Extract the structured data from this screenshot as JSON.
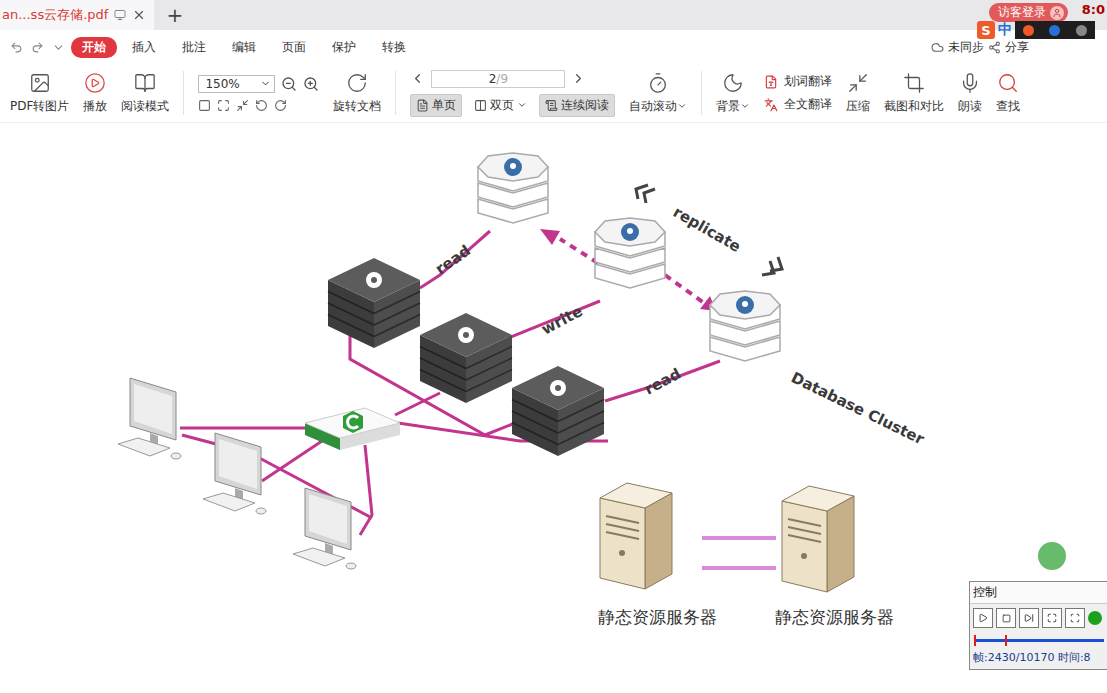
{
  "tab_bar": {
    "doc_tab": "an...ss云存储.pdf",
    "new_tab": "+",
    "login": "访客登录",
    "clock": "8:0"
  },
  "ime": {
    "logo": "S",
    "mode": "中"
  },
  "menu": [
    {
      "label": "开始",
      "selected": true
    },
    {
      "label": "插入",
      "selected": false
    },
    {
      "label": "批注",
      "selected": false
    },
    {
      "label": "编辑",
      "selected": false
    },
    {
      "label": "页面",
      "selected": false
    },
    {
      "label": "保护",
      "selected": false
    },
    {
      "label": "转换",
      "selected": false
    }
  ],
  "menu_right": [
    "未同步",
    "分享"
  ],
  "toolbar": {
    "left_tools": [
      "PDF转图片",
      "播放",
      "阅读模式"
    ],
    "zoom": "150%",
    "rotate": "旋转文档",
    "page_current": "2",
    "page_total": "/9",
    "views": [
      {
        "label": "单页",
        "selected": true
      },
      {
        "label": "双页",
        "selected": false
      },
      {
        "label": "连续阅读",
        "selected": true
      }
    ],
    "auto_scroll": "自动滚动",
    "background": "背景",
    "translate": [
      "划词翻译",
      "全文翻译"
    ],
    "right_tools": [
      "压缩",
      "截图和对比",
      "朗读",
      "查找"
    ]
  },
  "diagram": {
    "read_top": "read",
    "write": "write",
    "read_bottom": "read",
    "replicate": "replicate",
    "cluster": "Database Cluster",
    "static_servers": [
      "静态资源服务器",
      "静态资源服务器"
    ]
  },
  "control": {
    "title": "控制",
    "level": 0.24,
    "readout": "帧:2430/10170 时间:8"
  }
}
